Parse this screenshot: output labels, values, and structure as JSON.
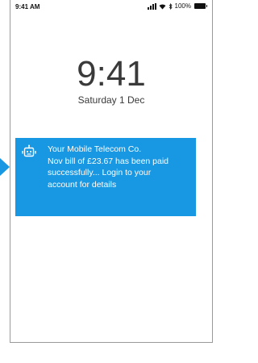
{
  "status_bar": {
    "time": "9:41 AM",
    "battery_percent": "100%",
    "icons": [
      "signal-icon",
      "wifi-icon",
      "bluetooth-icon",
      "battery-icon"
    ]
  },
  "lock_screen": {
    "time": "9:41",
    "date": "Saturday 1 Dec"
  },
  "notification": {
    "icon": "robot-icon",
    "lines": [
      "Your Mobile Telecom Co.",
      "Nov bill of £23.67 has been paid",
      "successfully... Login to your",
      "account for details"
    ]
  },
  "colors": {
    "accent": "#1897e2",
    "text": "#3a3a3a",
    "frame": "#9a9a9a"
  }
}
